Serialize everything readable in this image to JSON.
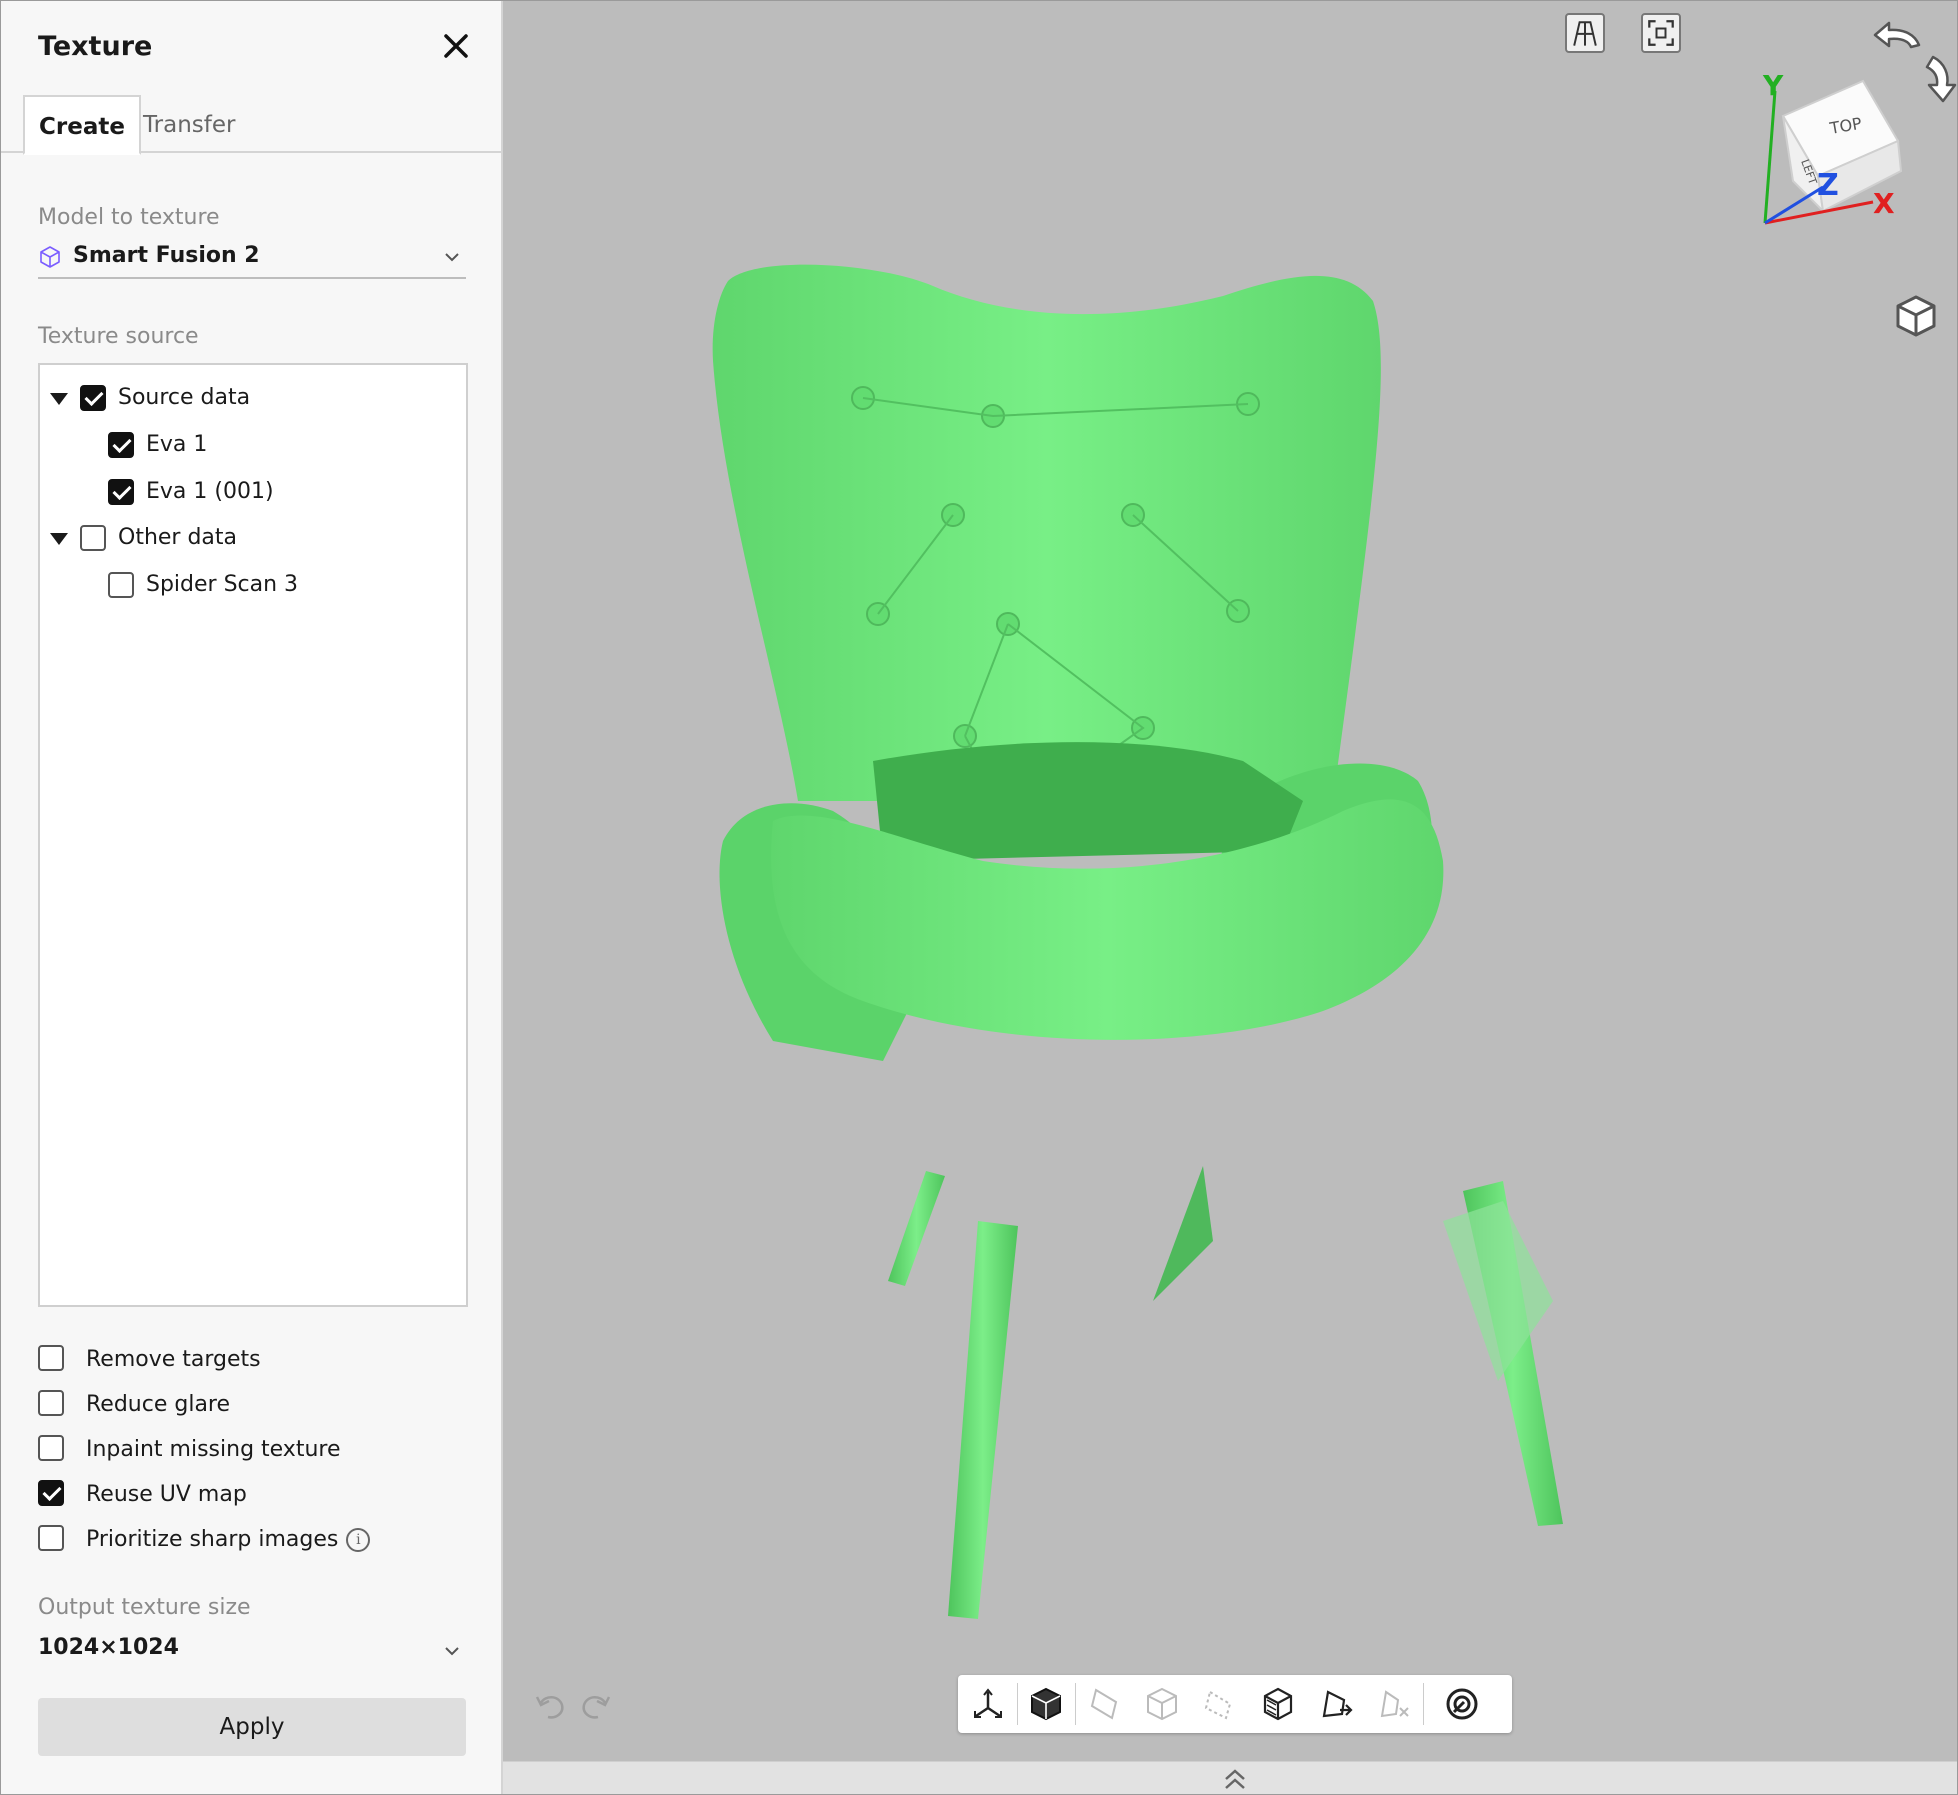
{
  "panel": {
    "title": "Texture",
    "tabs": [
      {
        "label": "Create",
        "active": true
      },
      {
        "label": "Transfer",
        "active": false
      }
    ],
    "model_section_label": "Model to texture",
    "model_value": "Smart Fusion 2",
    "source_section_label": "Texture source",
    "tree": [
      {
        "label": "Source data",
        "checked": true,
        "expanded": true,
        "children": [
          {
            "label": "Eva 1",
            "checked": true
          },
          {
            "label": "Eva 1 (001)",
            "checked": true
          }
        ]
      },
      {
        "label": "Other data",
        "checked": false,
        "expanded": true,
        "children": [
          {
            "label": "Spider Scan 3",
            "checked": false
          }
        ]
      }
    ],
    "options": [
      {
        "label": "Remove targets",
        "checked": false
      },
      {
        "label": "Reduce glare",
        "checked": false
      },
      {
        "label": "Inpaint missing texture",
        "checked": false
      },
      {
        "label": "Reuse UV map",
        "checked": true
      },
      {
        "label": "Prioritize sharp images",
        "checked": false
      }
    ],
    "output_section_label": "Output texture size",
    "output_value": "1024×1024",
    "apply_label": "Apply"
  },
  "viewport": {
    "axis_labels": {
      "y": "Y",
      "z": "Z",
      "x": "X"
    },
    "cube_faces": {
      "top": "TOP",
      "left": "LEFT"
    },
    "colors": {
      "background": "#bcbcbc",
      "model": "#76ec84",
      "axis_x": "#e02020",
      "axis_y": "#22b022",
      "axis_z": "#2050e0"
    },
    "toolbar_icons": [
      "axes-icon",
      "solid-shading-icon",
      "flat-shading-icon",
      "wireframe-icon",
      "points-icon",
      "textured-icon",
      "lighting-icon",
      "texture-off-icon",
      "target-icon"
    ]
  }
}
